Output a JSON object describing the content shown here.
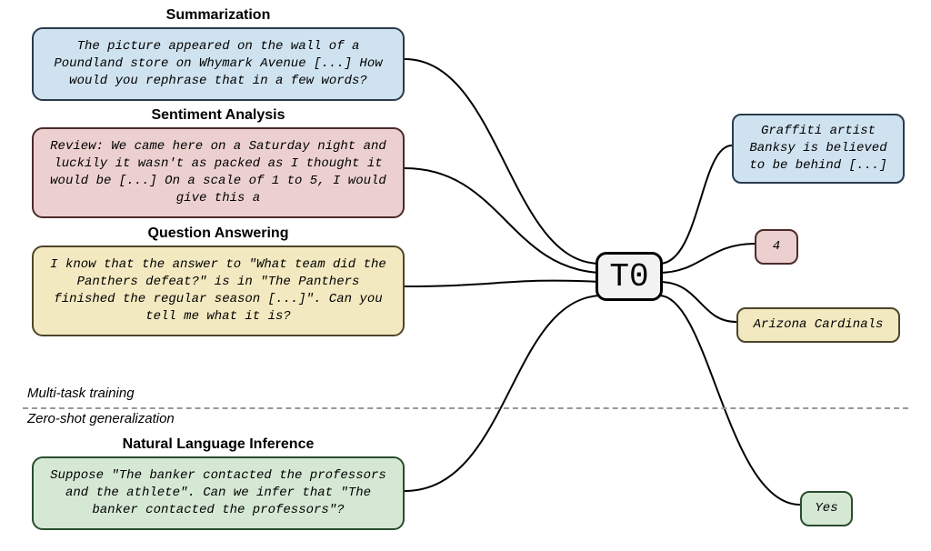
{
  "sections": {
    "training_label": "Multi-task training",
    "zeroshot_label": "Zero-shot generalization"
  },
  "model": {
    "name": "T0"
  },
  "tasks": {
    "summarization": {
      "title": "Summarization",
      "prompt": "The picture appeared on the wall of a Poundland store on Whymark Avenue [...] How would you rephrase that in a few words?",
      "output": "Graffiti artist Banksy is believed to be behind [...]"
    },
    "sentiment": {
      "title": "Sentiment Analysis",
      "prompt": "Review: We came here on a Saturday night and luckily it wasn't as packed as I thought it would be [...] On a scale of 1 to 5, I would give this a",
      "output": "4"
    },
    "qa": {
      "title": "Question Answering",
      "prompt": "I know that the answer to \"What team did the Panthers defeat?\" is in \"The Panthers finished the regular season [...]\". Can you tell me what it is?",
      "output": "Arizona Cardinals"
    },
    "nli": {
      "title": "Natural Language Inference",
      "prompt": "Suppose \"The banker contacted the professors and the athlete\". Can we infer that \"The banker contacted the professors\"?",
      "output": "Yes"
    }
  },
  "colors": {
    "blue": "#cfe2ef",
    "pink": "#ecd0d0",
    "yellow": "#f3e9c0",
    "green": "#d5e8d4",
    "model_bg": "#f2f2f2"
  }
}
